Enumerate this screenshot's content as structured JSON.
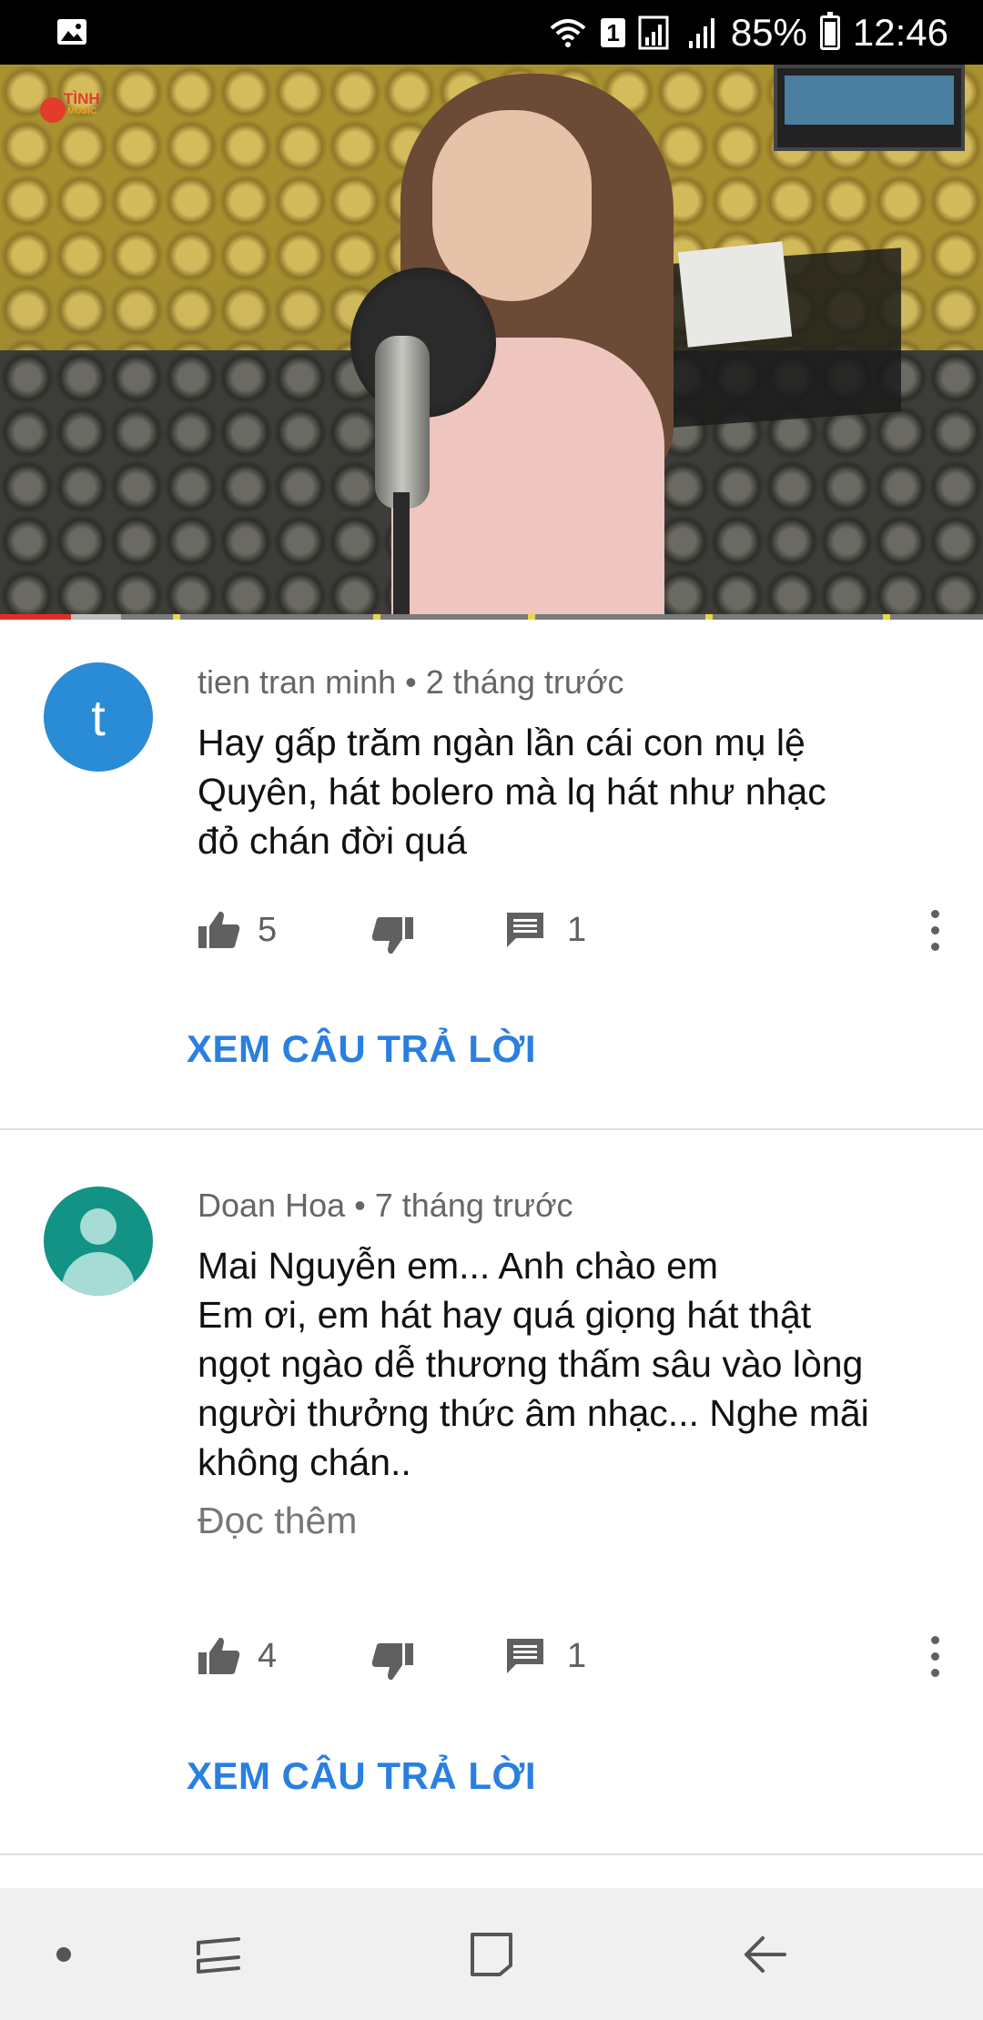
{
  "status_bar": {
    "sim_label": "1",
    "battery": "85%",
    "time": "12:46",
    "icons": [
      "gallery-icon",
      "wifi-icon",
      "signal-icon",
      "battery-icon"
    ]
  },
  "video": {
    "channel_logo_top": "TÌNH",
    "channel_logo_bottom": "MUSIC",
    "progress_played": 0.072,
    "progress_buffered": 0.123
  },
  "comments": [
    {
      "avatar_letter": "t",
      "avatar_color": "#2a8bd6",
      "author": "tien tran minh",
      "time": "2 tháng trước",
      "lines": [
        "Hay gấp trăm ngàn lần cái con mụ lệ",
        "Quyên, hát bolero mà lq hát như nhạc",
        "đỏ chán đời quá"
      ],
      "likes": "5",
      "replies": "1",
      "view_replies": "XEM CÂU TRẢ LỜI"
    },
    {
      "avatar_color": "#129385",
      "author": "Doan Hoa",
      "time": "7 tháng trước",
      "lines": [
        "Mai Nguyễn em... Anh chào em",
        "Em ơi, em hát hay quá giọng hát thật",
        "ngọt ngào dễ thương thấm sâu vào lòng",
        "người thưởng thức âm nhạc... Nghe mãi",
        "không chán.."
      ],
      "read_more": "Đọc thêm",
      "likes": "4",
      "replies": "1",
      "view_replies": "XEM CÂU TRẢ LỜI"
    }
  ],
  "meta_separator": "•",
  "accent_color": "#2a7fe0",
  "nav_icons": [
    "dot-icon",
    "recent-apps-icon",
    "home-icon",
    "back-icon"
  ]
}
